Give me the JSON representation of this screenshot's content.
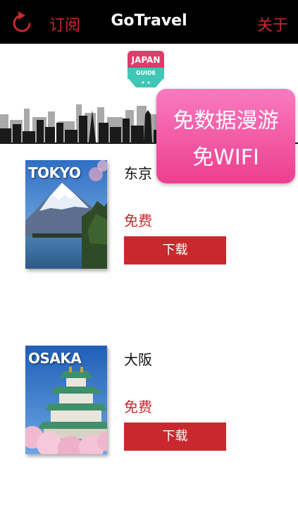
{
  "navbar": {
    "left_label": "订阅",
    "title": "GoTravel",
    "right_label": "关于",
    "accent_color": "#c8282e"
  },
  "hero": {
    "logo_top": "JAPAN",
    "logo_bottom": "GUIDE"
  },
  "promo": {
    "line1": "免数据漫游",
    "line2": "免WIFI"
  },
  "guides": [
    {
      "cover_label": "TOKYO",
      "name": "东京",
      "price": "免费",
      "button": "下载"
    },
    {
      "cover_label": "OSAKA",
      "name": "大阪",
      "price": "免费",
      "button": "下载"
    }
  ],
  "icons": [
    "refresh-icon",
    "japan-guide-logo"
  ]
}
